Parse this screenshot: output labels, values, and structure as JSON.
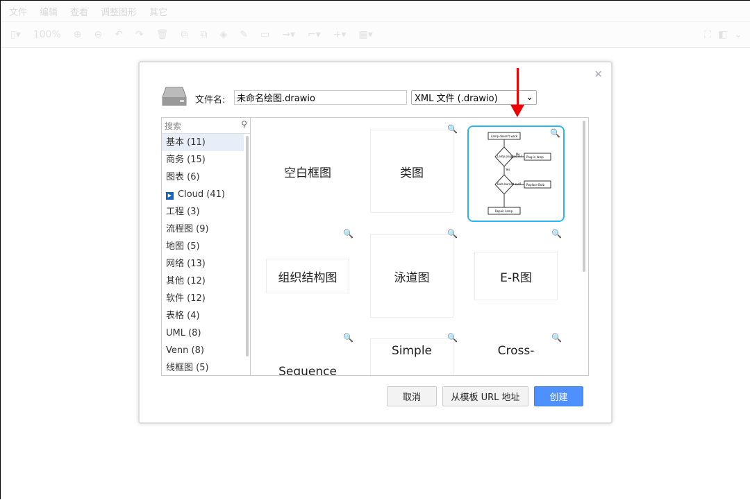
{
  "menu": [
    "文件",
    "编辑",
    "查看",
    "调整图形",
    "其它"
  ],
  "toolbar": {
    "zoom": "100%"
  },
  "dialog": {
    "filename_label": "文件名:",
    "filename_value": "未命名绘图.drawio",
    "format": "XML 文件 (.drawio)",
    "search_placeholder": "搜索",
    "categories": [
      "基本 (11)",
      "商务 (15)",
      "图表 (6)",
      "Cloud (41)",
      "工程 (3)",
      "流程图 (9)",
      "地图 (5)",
      "网络 (13)",
      "其他 (12)",
      "软件 (12)",
      "表格 (4)",
      "UML (8)",
      "Venn (8)",
      "线框图 (5)"
    ],
    "templates": [
      "空白框图",
      "类图",
      "",
      "组织结构图",
      "泳道图",
      "E-R图",
      "Sequence",
      "Simple",
      "Cross-"
    ],
    "flowchart": {
      "start": "Lamp doesn't work",
      "q1": "Lamp plugged in?",
      "a1": "Plug in lamp",
      "q2": "Bulb burned out?",
      "a2": "Replace Bulb",
      "end": "Repair Lamp",
      "no": "No",
      "yes": "Yes"
    },
    "buttons": {
      "cancel": "取消",
      "from_url": "从模板 URL 地址",
      "create": "创建"
    }
  }
}
